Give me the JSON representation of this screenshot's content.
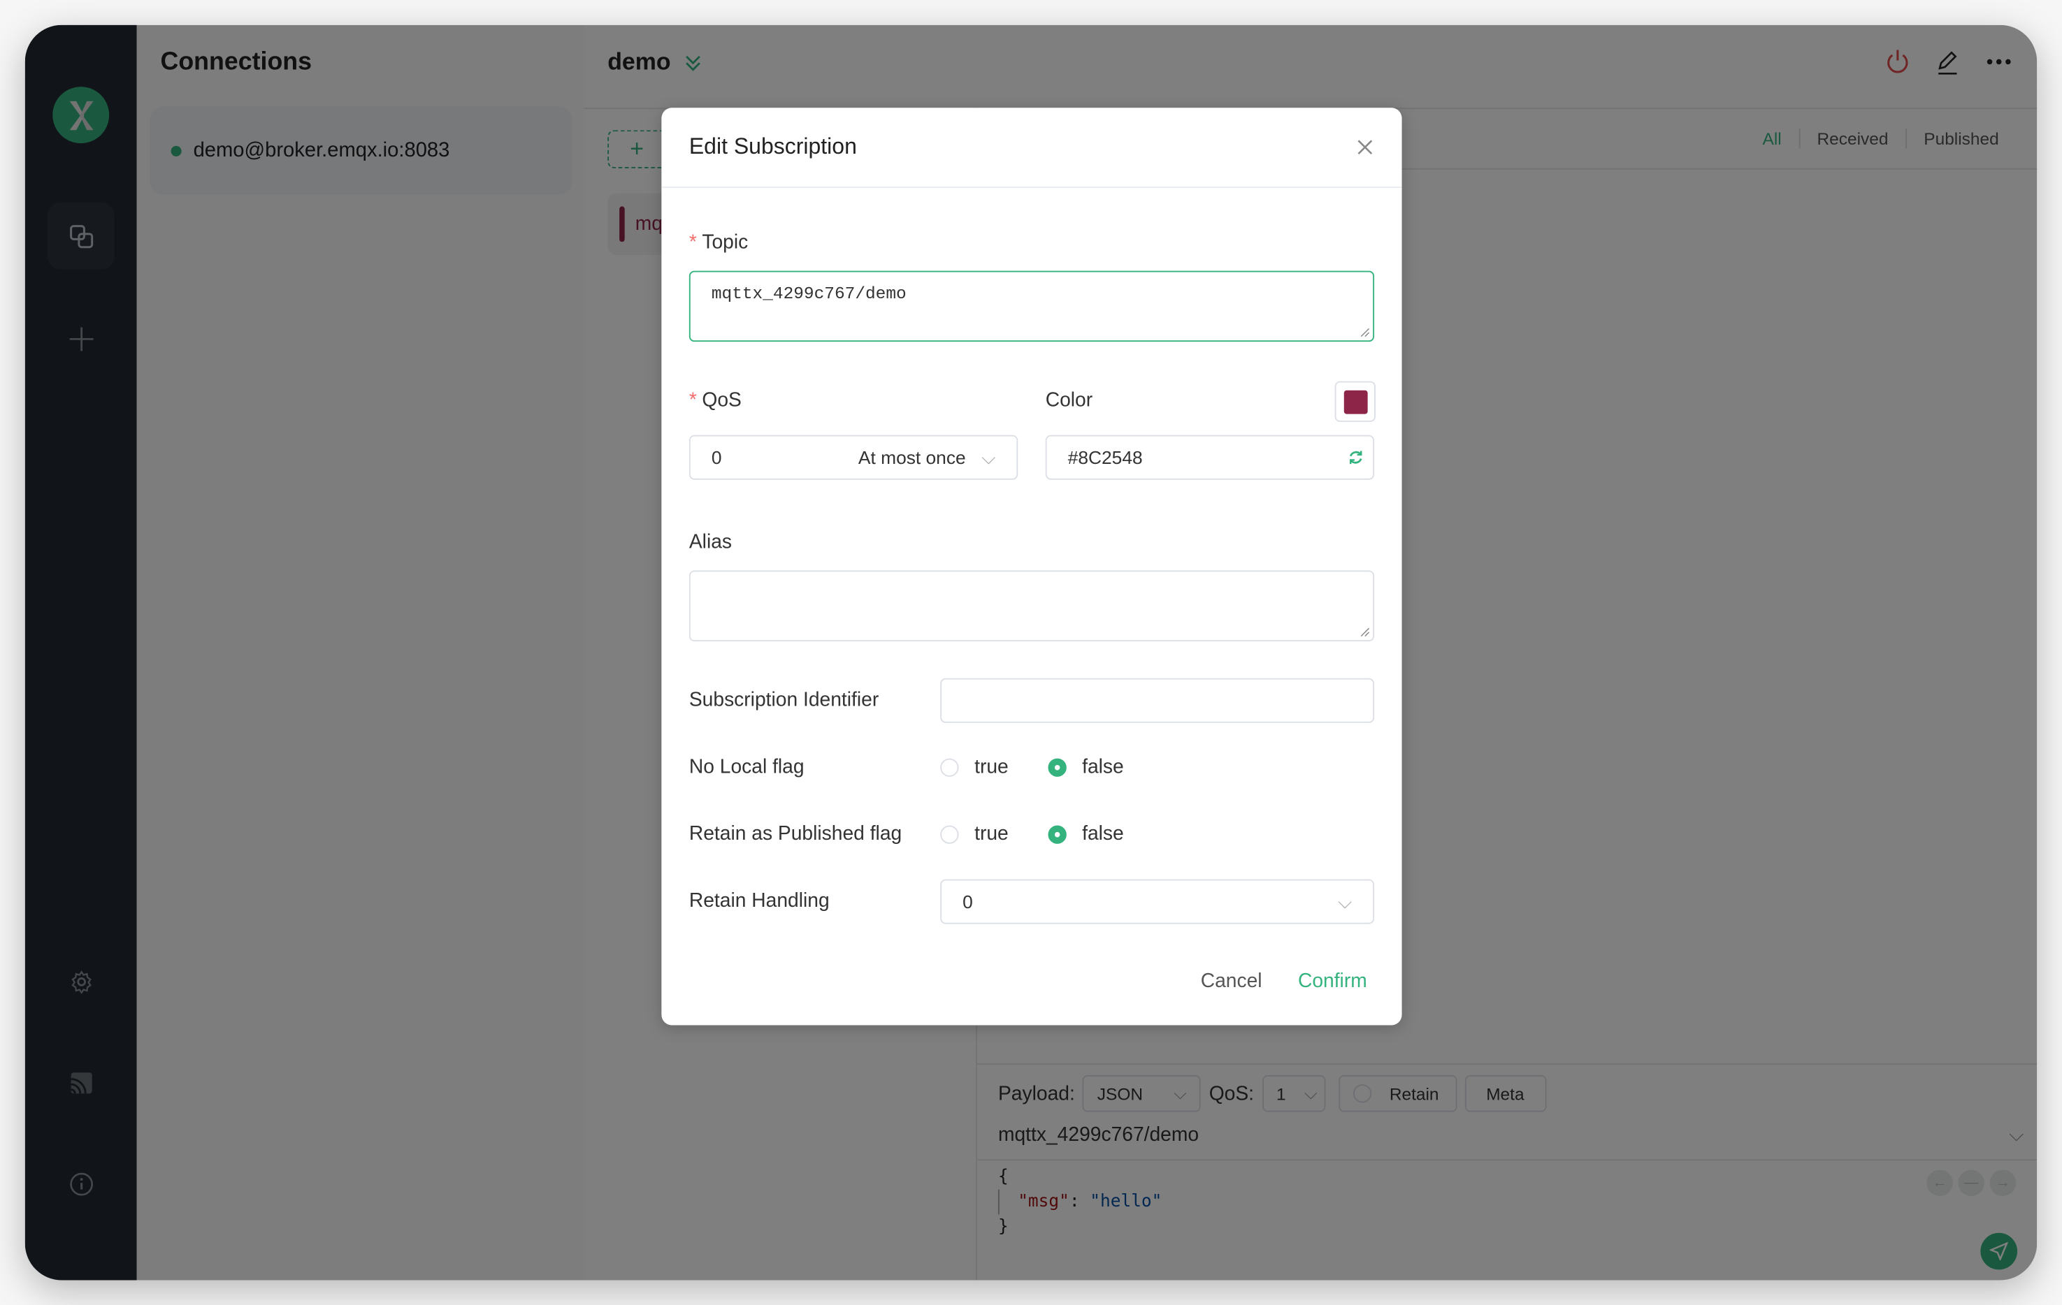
{
  "sidebar": {
    "nav": [
      "connections-icon",
      "new-connection-icon",
      "settings-icon",
      "log-icon",
      "about-icon"
    ]
  },
  "connections": {
    "title": "Connections",
    "items": [
      {
        "label": "demo@broker.emqx.io:8083",
        "status": "connected"
      }
    ]
  },
  "main": {
    "title": "demo",
    "add_subscription_label": "+",
    "subscription": {
      "topic_partial": "mq",
      "color": "#8C2548"
    },
    "tabs": [
      "All",
      "Received",
      "Published"
    ],
    "active_tab": "All"
  },
  "publish": {
    "payload_label": "Payload:",
    "payload_format": "JSON",
    "qos_label": "QoS:",
    "qos_value": "1",
    "retain_label": "Retain",
    "meta_label": "Meta",
    "topic": "mqttx_4299c767/demo",
    "code_lines": [
      "{",
      "\"msg\"",
      ": ",
      "\"hello\"",
      "}"
    ]
  },
  "dialog": {
    "title": "Edit Subscription",
    "topic_label": "Topic",
    "topic_value": "mqttx_4299c767/demo",
    "qos_label": "QoS",
    "qos_value": "0",
    "qos_desc": "At most once",
    "color_label": "Color",
    "color_value": "#8C2548",
    "alias_label": "Alias",
    "alias_value": "",
    "sub_id_label": "Subscription Identifier",
    "sub_id_value": "",
    "no_local_label": "No Local flag",
    "no_local_value": "false",
    "rap_label": "Retain as Published flag",
    "rap_value": "false",
    "radio_true": "true",
    "radio_false": "false",
    "retain_handling_label": "Retain Handling",
    "retain_handling_value": "0",
    "cancel_label": "Cancel",
    "confirm_label": "Confirm"
  },
  "colors": {
    "accent": "#35b37e",
    "danger": "#e04a4a",
    "sub_color": "#8C2548"
  }
}
